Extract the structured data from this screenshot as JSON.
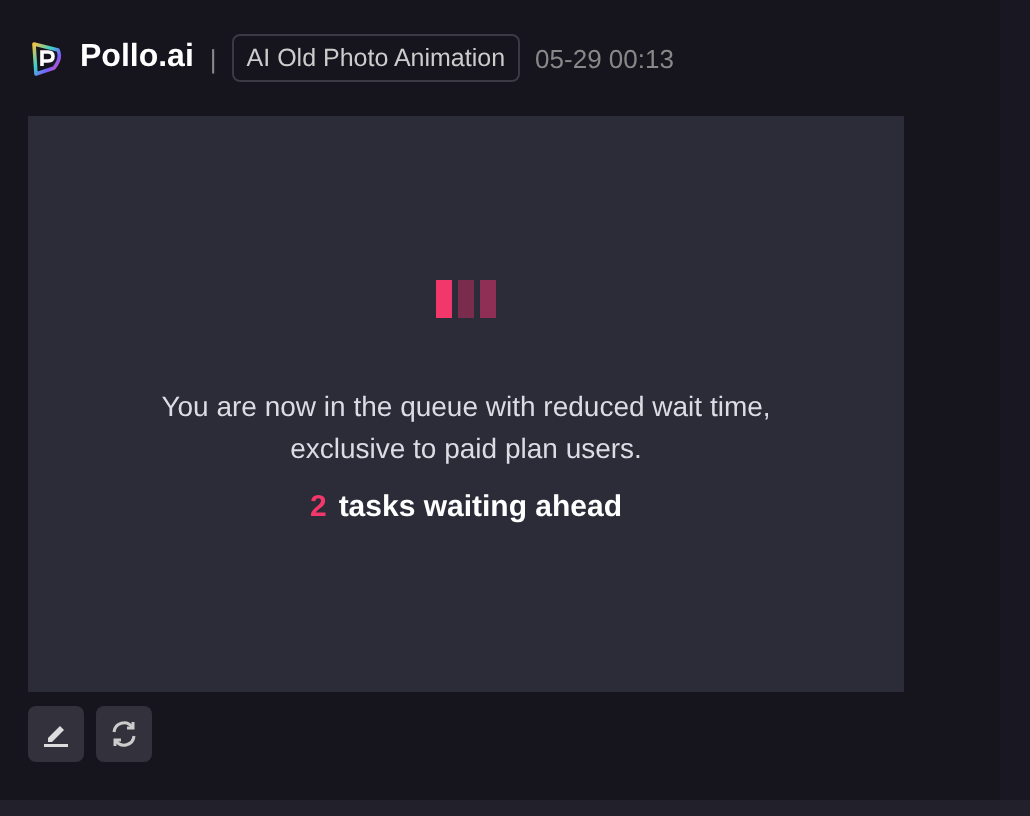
{
  "header": {
    "brand": "Pollo.ai",
    "separator": "|",
    "tag": "AI Old Photo Animation",
    "time": "05-29 00:13"
  },
  "queue": {
    "message": "You are now in the queue with reduced wait time, exclusive to paid plan users.",
    "count": "2",
    "count_label": "tasks waiting ahead"
  },
  "actions": [
    {
      "kind": "edit"
    },
    {
      "kind": "refresh"
    }
  ]
}
